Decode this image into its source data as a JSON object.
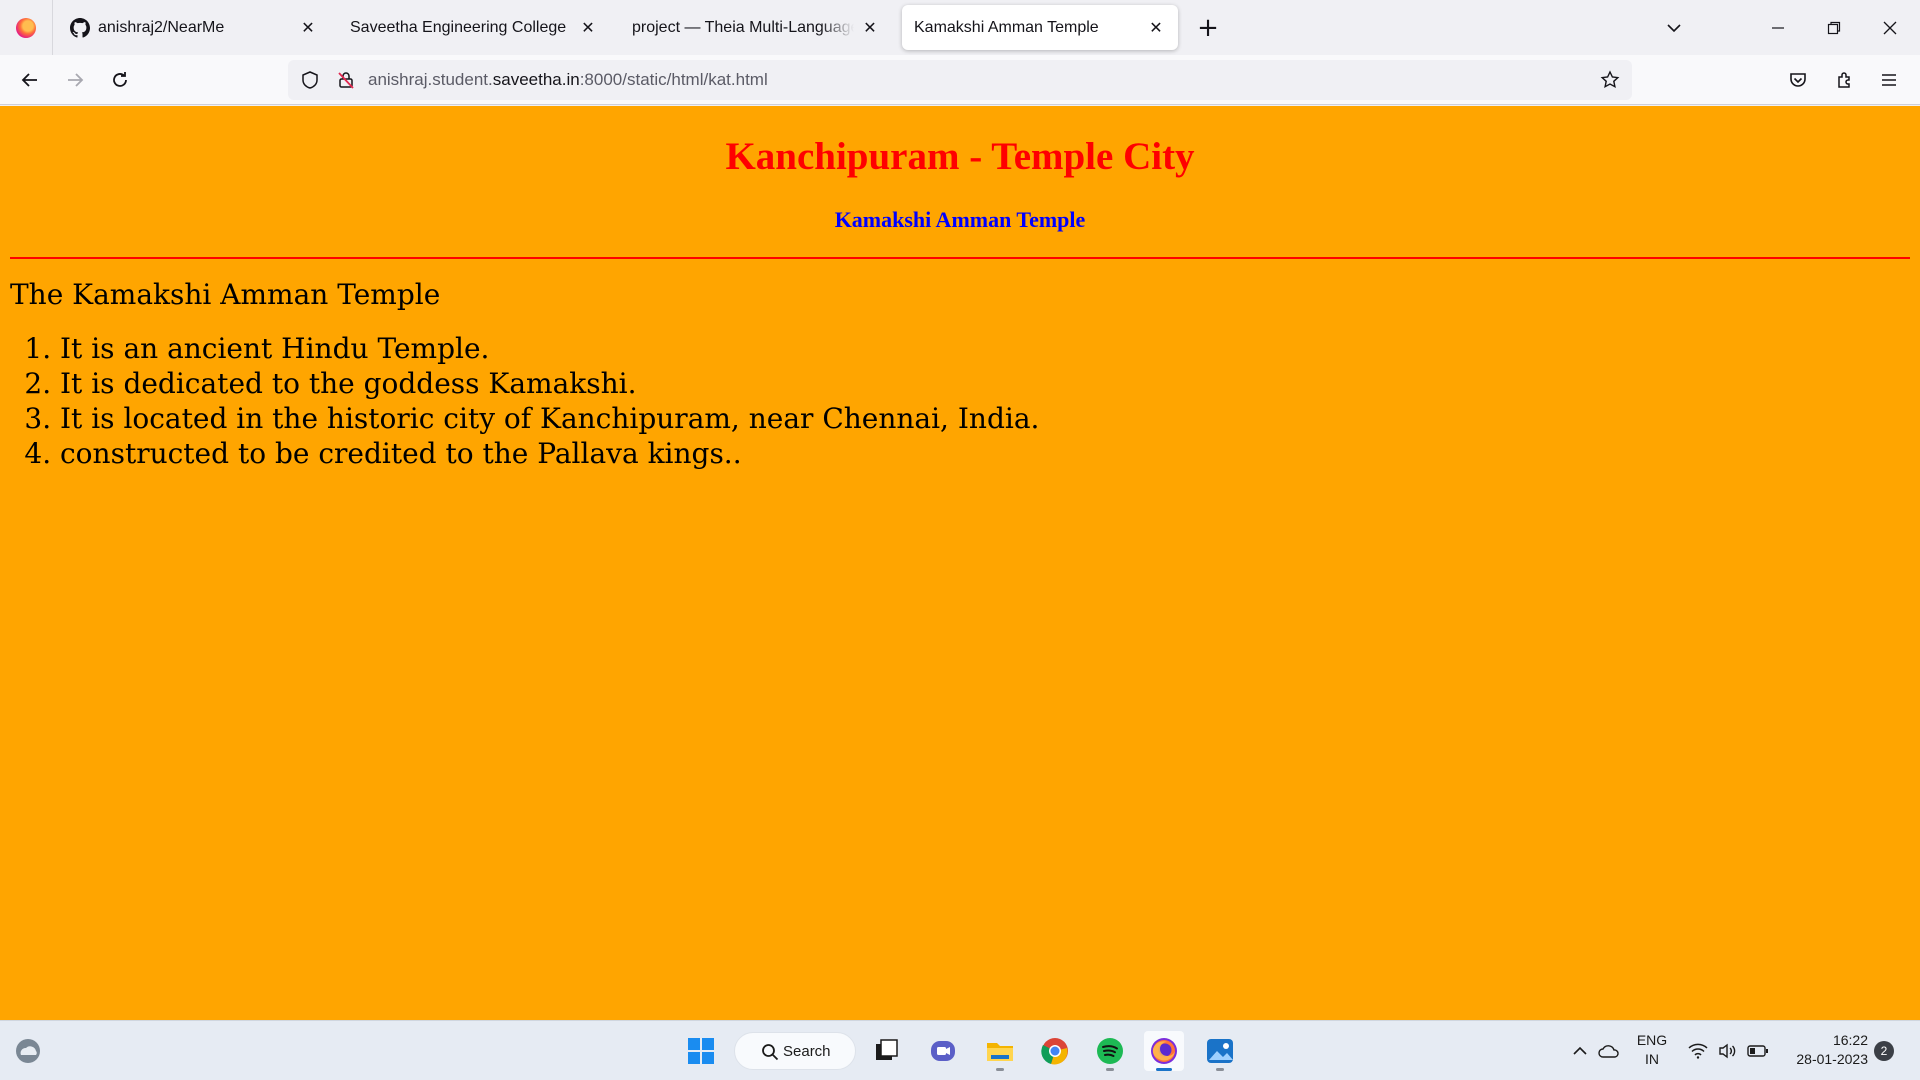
{
  "browser": {
    "tabs": [
      {
        "title": "anishraj2/NearMe",
        "icon": "github-icon"
      },
      {
        "title": "Saveetha Engineering College",
        "icon": "none"
      },
      {
        "title": "project — Theia Multi-Language Ex",
        "icon": "none"
      },
      {
        "title": "Kamakshi Amman Temple",
        "icon": "none",
        "active": true
      }
    ],
    "url": {
      "prefix": "anishraj.student.",
      "host": "saveetha.in",
      "suffix": ":8000/static/html/kat.html"
    }
  },
  "page": {
    "title": "Kanchipuram - Temple City",
    "subtitle": "Kamakshi Amman Temple",
    "lead": "The Kamakshi Amman Temple",
    "facts": [
      "It is an ancient Hindu Temple.",
      "It is dedicated to the goddess Kamakshi.",
      "It is located in the historic city of Kanchipuram, near Chennai, India.",
      "constructed to be credited to the Pallava kings.."
    ],
    "colors": {
      "background": "#ffa500",
      "title": "#ff0000",
      "subtitle": "#0000ff",
      "rule": "#ff0000"
    }
  },
  "taskbar": {
    "search_label": "Search",
    "apps": [
      "start-icon",
      "search-icon",
      "task-view-icon",
      "teams-chat-icon",
      "file-explorer-icon",
      "chrome-icon",
      "spotify-icon",
      "firefox-icon",
      "photos-icon"
    ],
    "lang_line1": "ENG",
    "lang_line2": "IN",
    "time": "16:22",
    "date": "28-01-2023",
    "notifications": "2"
  }
}
